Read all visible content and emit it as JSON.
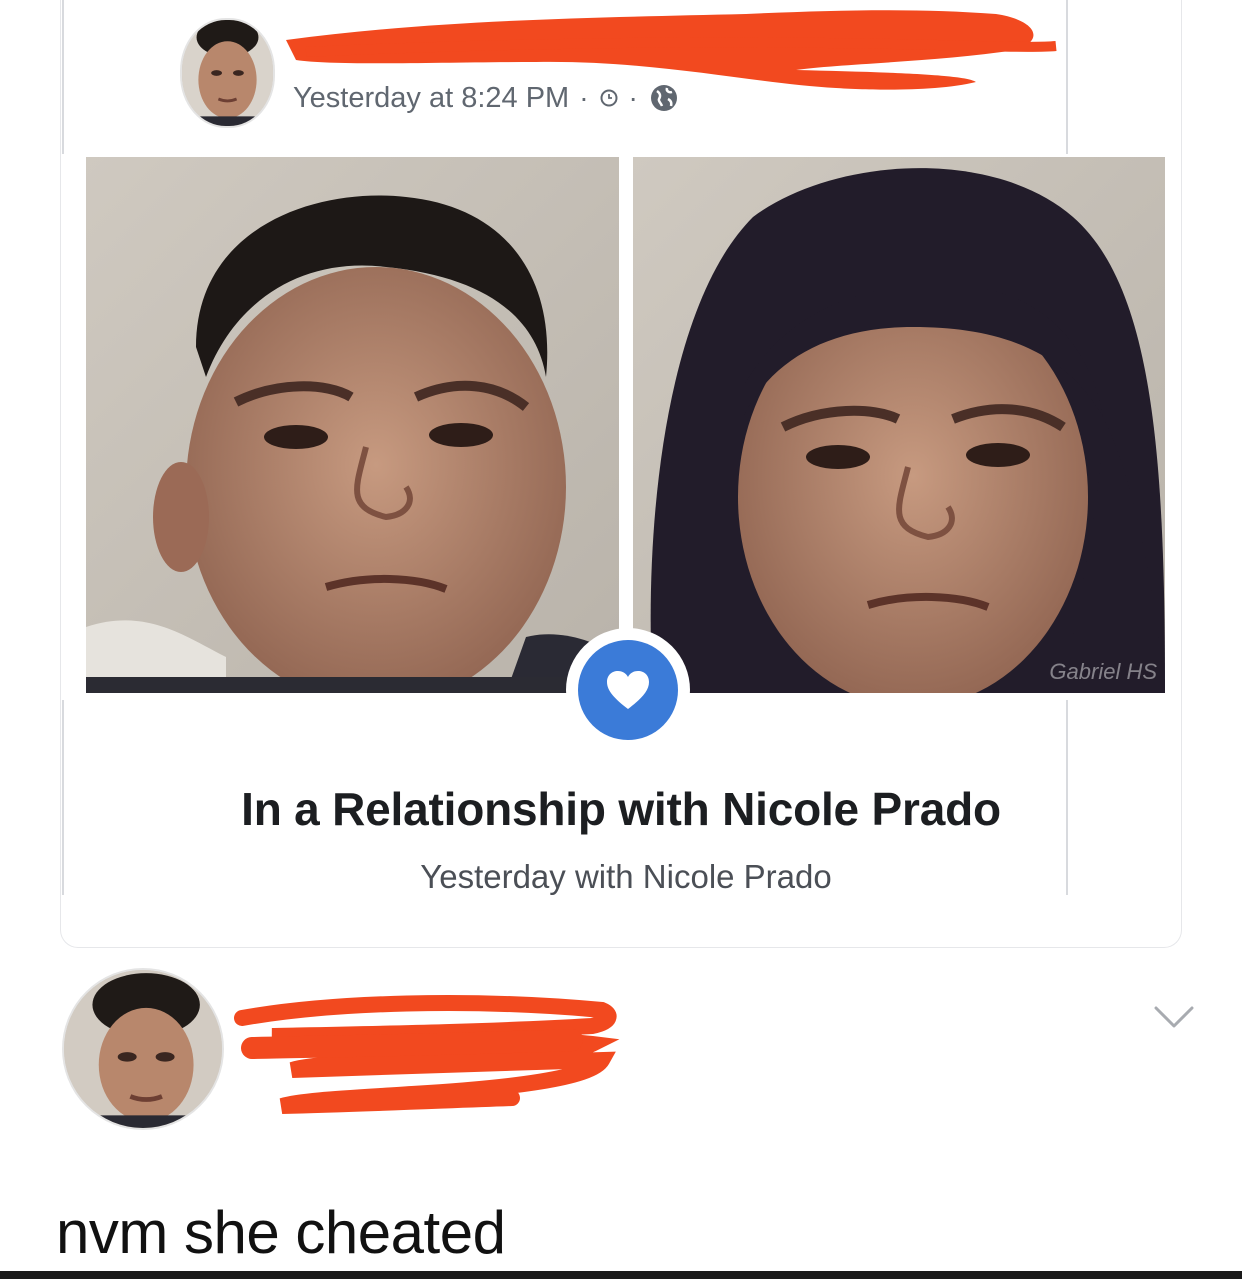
{
  "post": {
    "timestamp": "Yesterday at 8:24 PM",
    "separator": "·",
    "meta_icons": [
      "clock-icon",
      "globe-icon"
    ],
    "photo_watermark": "Gabriel HS"
  },
  "life_event": {
    "icon": "heart-icon",
    "title": "In a Relationship with Nicole Prado",
    "subtitle": "Yesterday with Nicole Prado"
  },
  "comment": {
    "text": "nvm she cheated"
  },
  "colors": {
    "redaction": "#f2491f",
    "heart_badge": "#3b7bd8",
    "meta_text": "#606770"
  }
}
